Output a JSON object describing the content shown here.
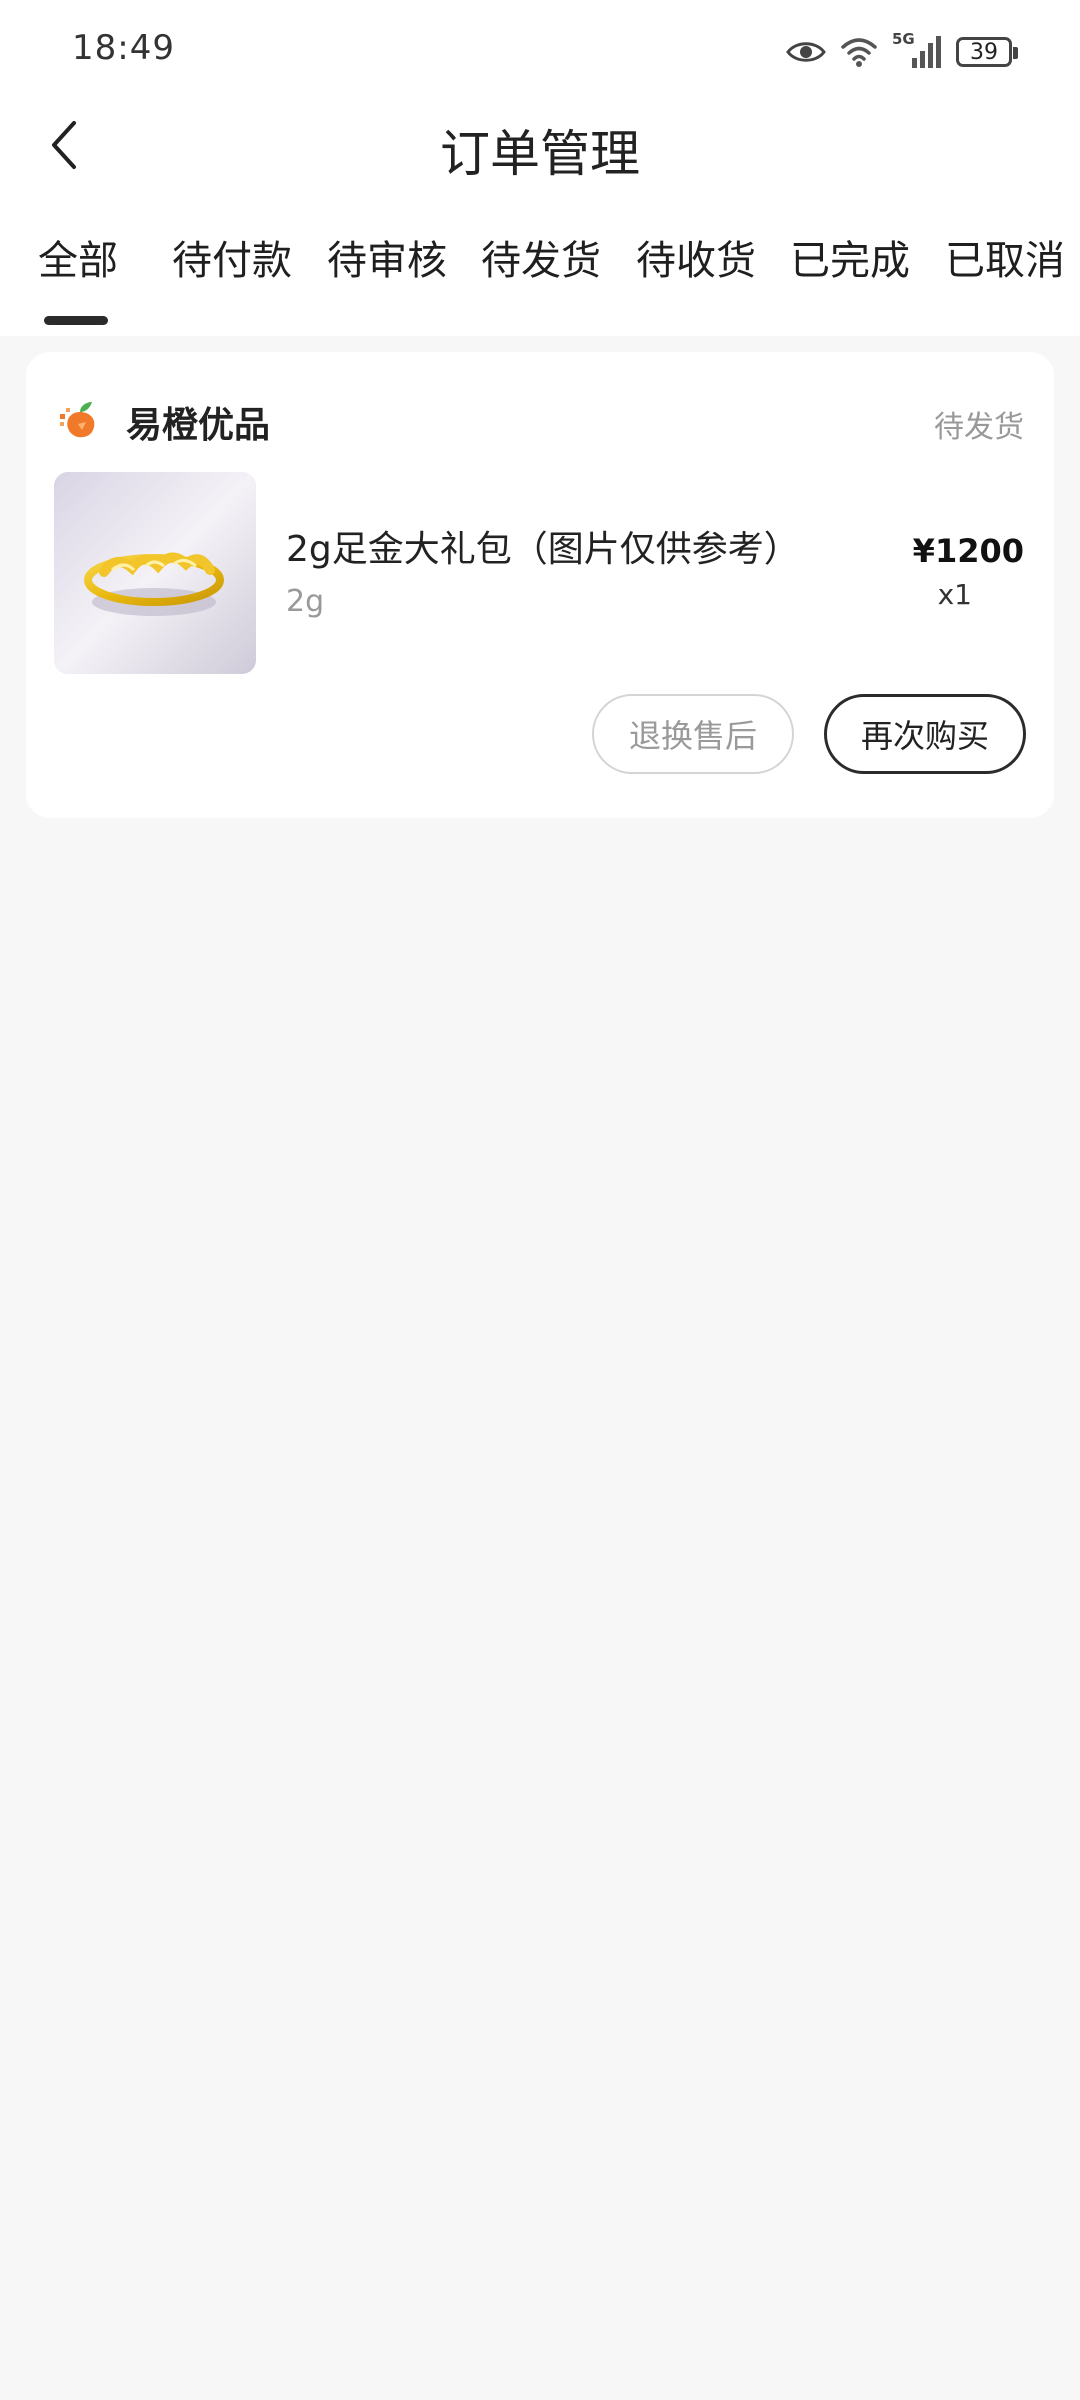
{
  "status_bar": {
    "time": "18:49",
    "icons": [
      "eye-icon",
      "wifi-icon",
      "signal-5g-icon",
      "battery-icon"
    ],
    "network_label": "5G",
    "battery_level": "39"
  },
  "header": {
    "back_icon": "chevron-left-icon",
    "title": "订单管理"
  },
  "tabs": {
    "active_index": 0,
    "items": [
      {
        "label": "全部"
      },
      {
        "label": "待付款"
      },
      {
        "label": "待审核"
      },
      {
        "label": "待发货"
      },
      {
        "label": "待收货"
      },
      {
        "label": "已完成"
      },
      {
        "label": "已取消"
      }
    ]
  },
  "orders": [
    {
      "shop_name": "易橙优品",
      "shop_logo_icon": "orange-logo-icon",
      "status": "待发货",
      "product": {
        "image_icon": "gold-ring-image",
        "name": "2g足金大礼包（图片仅供参考）",
        "spec": "2g",
        "price": "¥1200",
        "quantity": "x1"
      },
      "actions": {
        "after_sale": "退换售后",
        "rebuy": "再次购买"
      }
    }
  ],
  "colors": {
    "page_bg": "#f7f7f7",
    "card_bg": "#ffffff",
    "tab_indicator": "#2b2b2b",
    "muted_text": "#999999",
    "gold": "#e9b90f",
    "logo_orange": "#f07a2a"
  }
}
